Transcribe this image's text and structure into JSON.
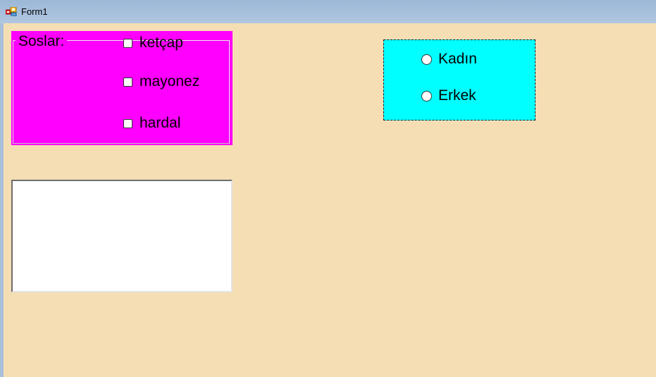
{
  "window": {
    "title": "Form1",
    "icon": "winforms-app-icon"
  },
  "sauces_group": {
    "label": "Soslar:",
    "background": "#ff00ff",
    "options": [
      {
        "label": "ketçap",
        "checked": false
      },
      {
        "label": "mayonez",
        "checked": false
      },
      {
        "label": "hardal",
        "checked": false
      }
    ]
  },
  "textbox": {
    "value": ""
  },
  "gender_panel": {
    "background": "#00ffff",
    "options": [
      {
        "label": "Kadın",
        "selected": false
      },
      {
        "label": "Erkek",
        "selected": false
      }
    ]
  },
  "colors": {
    "form_background": "#f5deb3",
    "titlebar": "#a9c0db"
  }
}
